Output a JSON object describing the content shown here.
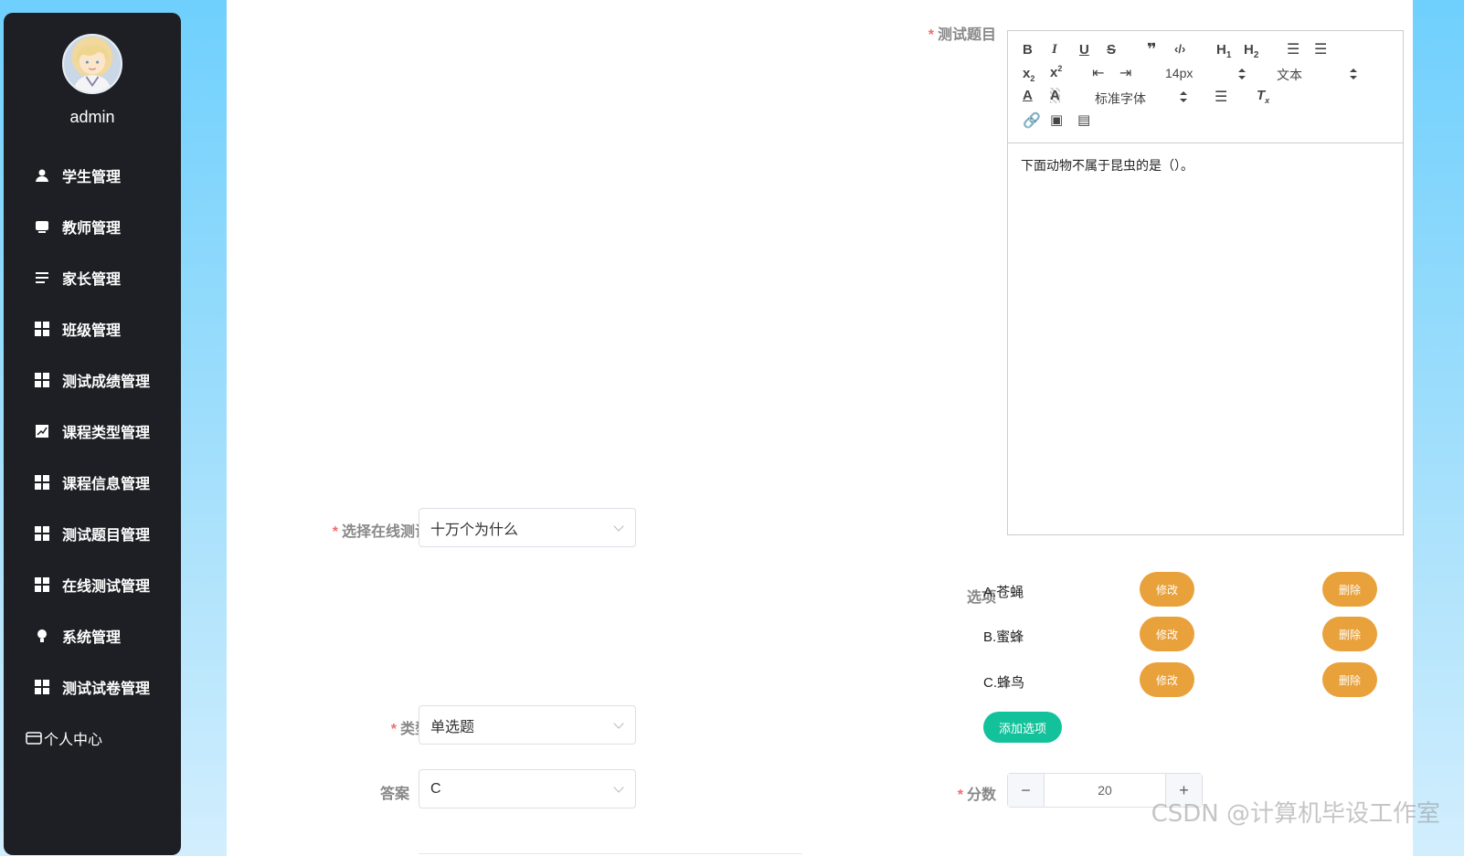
{
  "user": {
    "name": "admin"
  },
  "menu": [
    {
      "label": "学生管理",
      "icon": "user-icon"
    },
    {
      "label": "教师管理",
      "icon": "monitor-icon"
    },
    {
      "label": "家长管理",
      "icon": "list-icon"
    },
    {
      "label": "班级管理",
      "icon": "grid-icon"
    },
    {
      "label": "测试成绩管理",
      "icon": "grid-icon"
    },
    {
      "label": "课程类型管理",
      "icon": "chart-icon"
    },
    {
      "label": "课程信息管理",
      "icon": "grid-icon"
    },
    {
      "label": "测试题目管理",
      "icon": "grid-icon"
    },
    {
      "label": "在线测试管理",
      "icon": "grid-icon"
    },
    {
      "label": "系统管理",
      "icon": "bulb-icon"
    },
    {
      "label": "测试试卷管理",
      "icon": "grid-icon"
    },
    {
      "label": "个人中心",
      "icon": "card-icon"
    }
  ],
  "form": {
    "question_label": "测试题目",
    "exam_label": "选择在线测试",
    "exam_value": "十万个为什么",
    "options_label": "选项",
    "type_label": "类型",
    "type_value": "单选题",
    "answer_label": "答案",
    "answer_value": "C",
    "score_label": "分数",
    "score_value": "20"
  },
  "editor": {
    "font_size": "14px",
    "block_type": "文本",
    "font_family": "标准字体",
    "content": "下面动物不属于昆虫的是（）。"
  },
  "options": [
    {
      "text": "A.苍蝇",
      "edit": "修改",
      "delete": "删除"
    },
    {
      "text": "B.蜜蜂",
      "edit": "修改",
      "delete": "删除"
    },
    {
      "text": "C.蜂鸟",
      "edit": "修改",
      "delete": "删除"
    }
  ],
  "add_option_label": "添加选项",
  "watermark": "CSDN @计算机毕设工作室"
}
